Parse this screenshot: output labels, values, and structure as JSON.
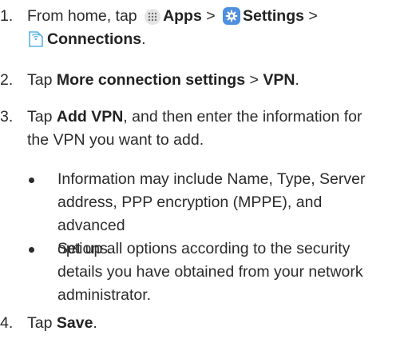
{
  "steps": [
    {
      "number": "1.",
      "t1": "From home, tap",
      "apps": "Apps",
      "sep1": ">",
      "settings": "Settings",
      "sep2": ">",
      "connections": "Connections",
      "end": "."
    },
    {
      "number": "2.",
      "t1": "Tap",
      "more": "More connection settings",
      "sep": ">",
      "vpn": "VPN",
      "end": "."
    },
    {
      "number": "3.",
      "t1": "Tap",
      "add": "Add VPN",
      "line1_rest": ", and then enter the information for",
      "line2": "the VPN you want to add."
    },
    {
      "number": "4.",
      "t1": "Tap",
      "save": "Save",
      "end": "."
    }
  ],
  "bullets": [
    {
      "lines": [
        "Information may include Name, Type, Server",
        "address, PPP encryption (MPPE), and advanced",
        "options."
      ]
    },
    {
      "lines": [
        "Set up all options according to the security",
        "details you have obtained from your network",
        "administrator."
      ]
    }
  ],
  "icons": {
    "apps": "apps-grid-icon",
    "settings": "settings-gear-icon",
    "connections": "connections-icon"
  },
  "colors": {
    "text": "#2b2b2b",
    "settings_icon": "#4e8fe0",
    "connections_icon": "#5ab1e8"
  }
}
